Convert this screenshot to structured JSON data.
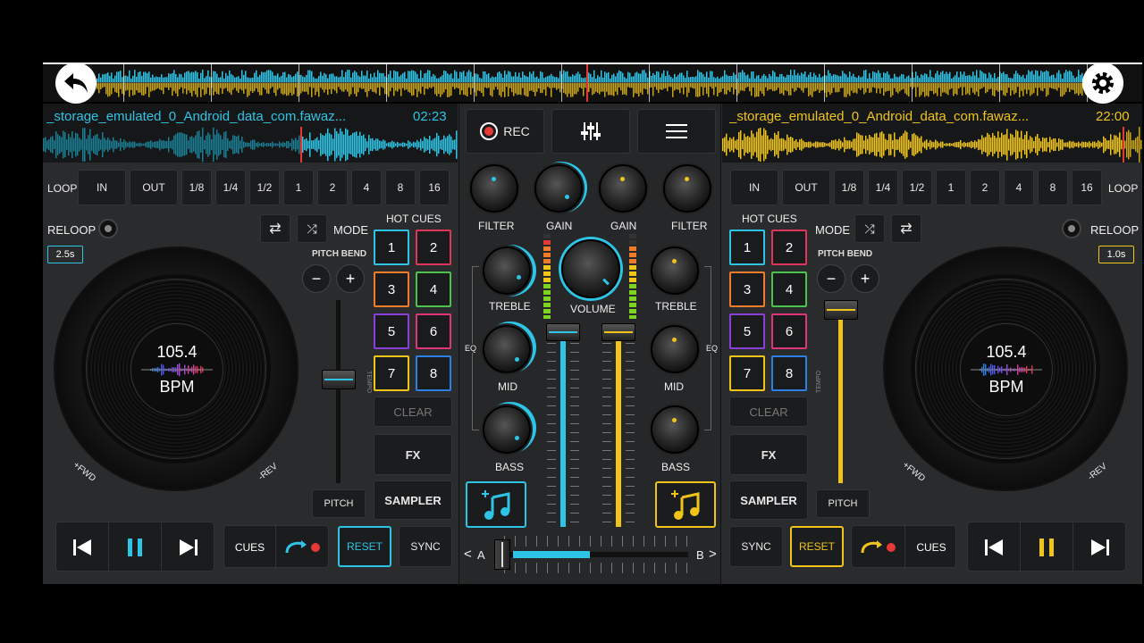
{
  "header": {
    "back_icon": "back-arrow-icon",
    "settings_icon": "gear-icon"
  },
  "deck_left": {
    "title": "_storage_emulated_0_Android_data_com.fawaz...",
    "time": "02:23",
    "loop_label": "LOOP",
    "loop_buttons": [
      "IN",
      "OUT",
      "1/8",
      "1/4",
      "1/2",
      "1",
      "2",
      "4",
      "8",
      "16"
    ],
    "reloop": "RELOOP",
    "reloop_value": "2.5s",
    "mode": "MODE",
    "pitch_bend": "PITCH BEND",
    "minus": "−",
    "plus": "+",
    "tempo": "TEMPO",
    "pitch": "PITCH",
    "bpm_value": "105.4",
    "bpm_unit": "BPM",
    "fwd": "+FWD",
    "rev": "-REV",
    "hot_cues": "HOT CUES",
    "pads": [
      "1",
      "2",
      "3",
      "4",
      "5",
      "6",
      "7",
      "8"
    ],
    "clear": "CLEAR",
    "fx": "FX",
    "sampler": "SAMPLER",
    "cues": "CUES",
    "reset": "RESET",
    "sync": "SYNC",
    "accent": "#2ec4e6"
  },
  "deck_right": {
    "title": "_storage_emulated_0_Android_data_com.fawaz...",
    "time": "22:00",
    "loop_label": "LOOP",
    "loop_buttons": [
      "IN",
      "OUT",
      "1/8",
      "1/4",
      "1/2",
      "1",
      "2",
      "4",
      "8",
      "16"
    ],
    "reloop": "RELOOP",
    "reloop_value": "1.0s",
    "mode": "MODE",
    "pitch_bend": "PITCH BEND",
    "minus": "−",
    "plus": "+",
    "tempo": "TEMPO",
    "pitch": "PITCH",
    "bpm_value": "105.4",
    "bpm_unit": "BPM",
    "fwd": "+FWD",
    "rev": "-REV",
    "hot_cues": "HOT CUES",
    "pads": [
      "1",
      "2",
      "3",
      "4",
      "5",
      "6",
      "7",
      "8"
    ],
    "clear": "CLEAR",
    "fx": "FX",
    "sampler": "SAMPLER",
    "cues": "CUES",
    "reset": "RESET",
    "sync": "SYNC",
    "accent": "#f0c419"
  },
  "mixer": {
    "rec": "REC",
    "filter": "FILTER",
    "gain": "GAIN",
    "treble": "TREBLE",
    "volume": "VOLUME",
    "mid": "MID",
    "bass": "BASS",
    "eq": "EQ",
    "cross_a": "A",
    "cross_b": "B",
    "prev": "<",
    "next": ">",
    "crossfader_position": 0.0
  },
  "colors": {
    "blue": "#2ec4e6",
    "yellow": "#f0c419",
    "red": "#e53935"
  }
}
